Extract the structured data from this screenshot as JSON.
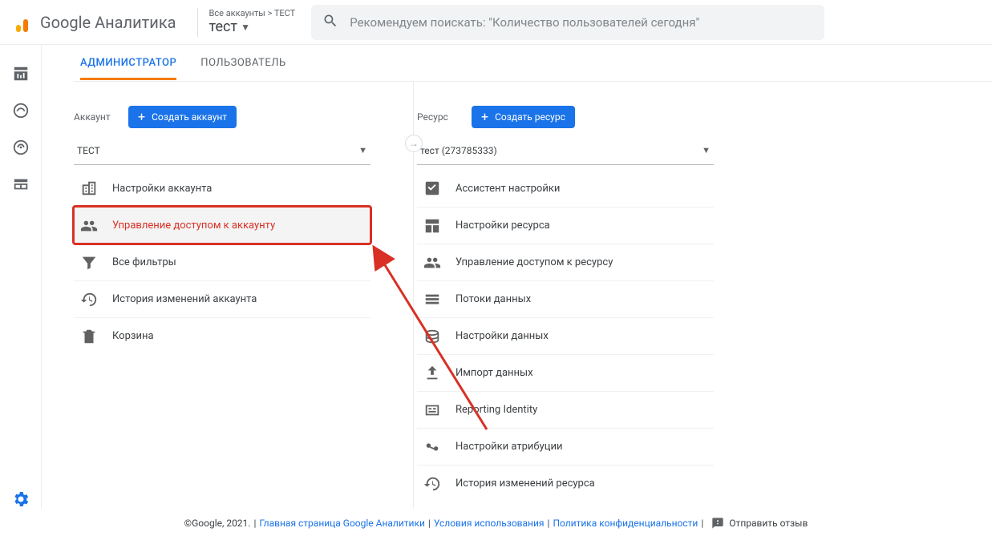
{
  "header": {
    "product": "Google Аналитика",
    "breadcrumb_top": "Все аккаунты > ТЕСТ",
    "breadcrumb_main": "тест",
    "search_placeholder": "Рекомендуем поискать: \"Количество пользователей сегодня\""
  },
  "tabs": {
    "admin": "АДМИНИСТРАТОР",
    "user": "ПОЛЬЗОВАТЕЛЬ"
  },
  "account_col": {
    "label": "Аккаунт",
    "create_btn": "Создать аккаунт",
    "select_value": "ТЕСТ",
    "items": [
      "Настройки аккаунта",
      "Управление доступом к аккаунту",
      "Все фильтры",
      "История изменений аккаунта",
      "Корзина"
    ]
  },
  "resource_col": {
    "label": "Ресурс",
    "create_btn": "Создать ресурс",
    "select_value": "тест (273785333)",
    "items": [
      "Ассистент настройки",
      "Настройки ресурса",
      "Управление доступом к ресурсу",
      "Потоки данных",
      "Настройки данных",
      "Импорт данных",
      "Reporting Identity",
      "Настройки атрибуции",
      "История изменений ресурса"
    ]
  },
  "footer": {
    "copyright": "©Google, 2021.",
    "links": {
      "main": "Главная страница Google Аналитики",
      "terms": "Условия использования",
      "privacy": "Политика конфиденциальности"
    },
    "feedback": "Отправить отзыв"
  }
}
